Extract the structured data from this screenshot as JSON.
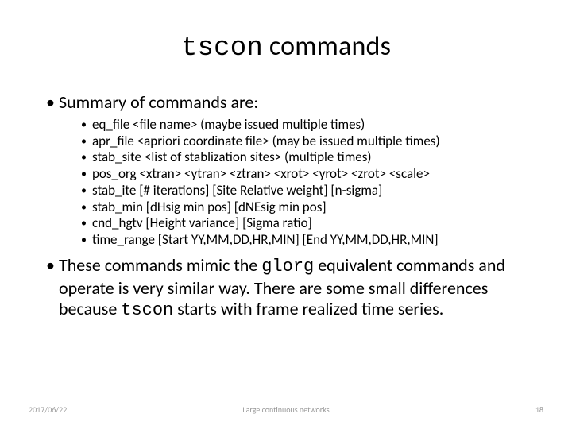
{
  "title": {
    "cmd": "tscon",
    "rest": " commands"
  },
  "summary_label": "Summary of commands are:",
  "commands": [
    "eq_file <file name>  (maybe issued multiple times)",
    "apr_file <apriori coordinate file> (may be issued multiple times)",
    "stab_site <list of stablization sites> (multiple times)",
    "pos_org <xtran> <ytran> <ztran> <xrot> <yrot> <zrot> <scale>",
    "stab_ite [# iterations] [Site Relative weight] [n-sigma]",
    "stab_min [dHsig min pos] [dNEsig min pos]",
    "cnd_hgtv [Height variance] [Sigma ratio]",
    "time_range [Start YY,MM,DD,HR,MIN] [End YY,MM,DD,HR,MIN]"
  ],
  "para": {
    "p1": "These commands mimic the ",
    "g": "glorg",
    "p2": " equivalent commands and operate is very similar way.  There are some small differences because ",
    "t": "tscon",
    "p3": " starts with frame realized time series."
  },
  "footer": {
    "date": "2017/06/22",
    "center": "Large continuous networks",
    "page": "18"
  }
}
